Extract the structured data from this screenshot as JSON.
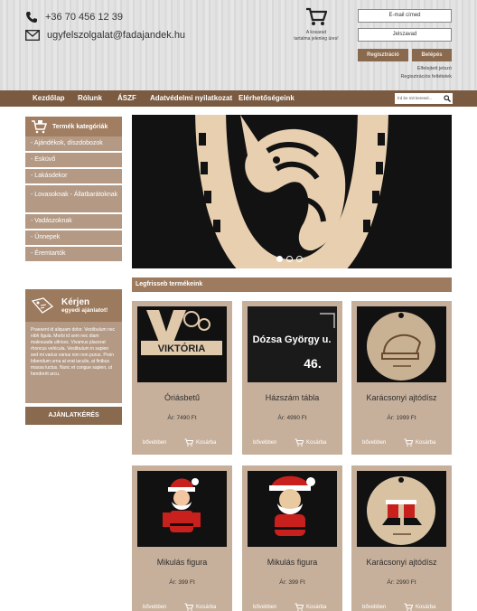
{
  "header": {
    "phone": "+36 70 456 12 39",
    "email": "ugyfelszolgalat@fadajandek.hu",
    "cart_line1": "A kosarad",
    "cart_line2": "tartalma jelenleg üres!",
    "email_placeholder": "E-mail címed",
    "password_placeholder": "Jelszavad",
    "register_label": "Regisztráció",
    "login_label": "Belépés",
    "forgot_label": "Elfelejtett jelszó",
    "terms_label": "Regisztrációs feltételek"
  },
  "nav": {
    "items": [
      "Kezdőlap",
      "Rólunk",
      "ÁSZF",
      "Adatvédelmi nyilatkozat",
      "Elérhetőségeink"
    ],
    "search_placeholder": "Írd be mit keresel..."
  },
  "sidebar": {
    "title": "Termék kategóriák",
    "items": [
      "- Ajándékok, díszdobozok",
      "- Esküvő",
      "- Lakásdekor",
      "- Lovasoknak - Állatbarátoknak",
      "- Vadászoknak",
      "- Ünnepek",
      "- Éremtartók"
    ]
  },
  "offer": {
    "title": "Kérjen",
    "subtitle": "egyedi ajánlatot!",
    "body": "Praesent id aliquam dolor. Vestibulum nec nibh ligula. Morbi id sem nec diam malesuada ultrices. Vivamus placerat rhoncus vehicula. Vestibulum in sapien sed mi varius varius non non purus. Proin bibendum urna at erat iaculis, at finibus massa luctus. Nunc et congue sapien, ut hendrerit arcu.",
    "button": "AJÁNLATKÉRÉS"
  },
  "slider": {
    "dots": 3,
    "active": 0
  },
  "products": {
    "title": "Legfrisseb termékeink",
    "more_label": "bővebben",
    "cart_label": "Kosárba",
    "items": [
      {
        "name": "Óriásbetű",
        "price": "Ár: 7490 Ft",
        "image_text": "VIKTÓRIA"
      },
      {
        "name": "Házszám tábla",
        "price": "Ár: 4990 Ft",
        "image_text": "Dózsa György u.",
        "image_text2": "46."
      },
      {
        "name": "Karácsonyi ajtódísz",
        "price": "Ár: 1999 Ft"
      },
      {
        "name": "Mikulás figura",
        "price": "Ár: 399 Ft"
      },
      {
        "name": "Mikulás figura",
        "price": "Ár: 399 Ft"
      },
      {
        "name": "Karácsonyi ajtódísz",
        "price": "Ár: 2990 Ft"
      }
    ]
  }
}
